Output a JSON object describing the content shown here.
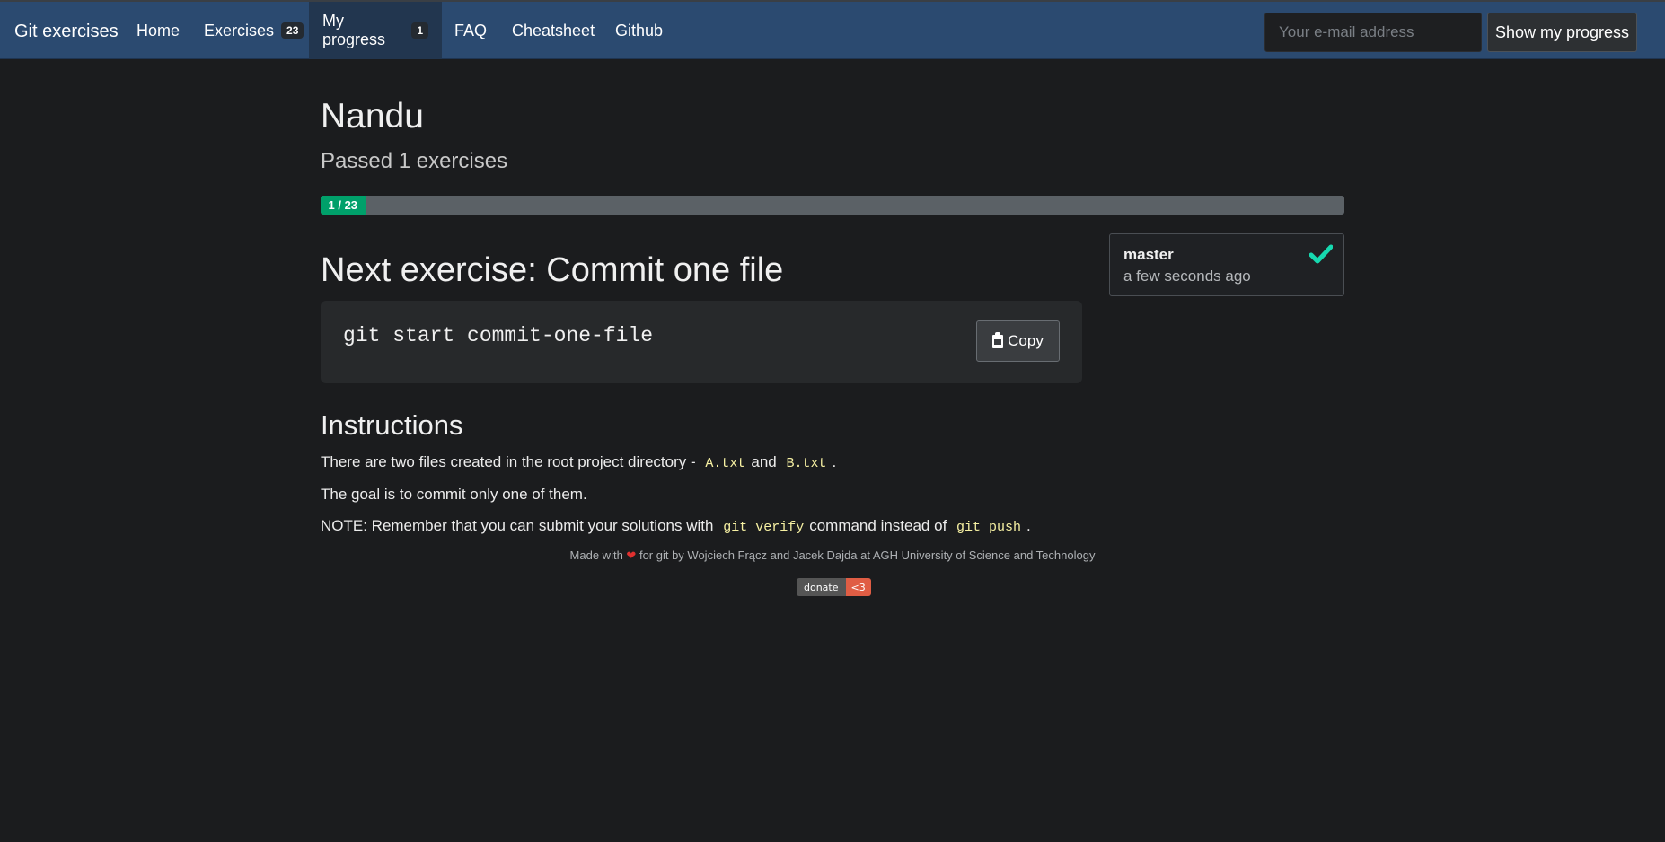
{
  "navbar": {
    "brand": "Git exercises",
    "items": [
      {
        "label": "Home"
      },
      {
        "label": "Exercises",
        "badge": "23"
      },
      {
        "label": "My progress",
        "badge": "1",
        "active": true
      },
      {
        "label": "FAQ"
      },
      {
        "label": "Cheatsheet"
      },
      {
        "label": "Github"
      }
    ],
    "email_placeholder": "Your e-mail address",
    "show_progress_label": "Show my progress"
  },
  "user": {
    "name": "Nandu",
    "passed_text": "Passed 1 exercises"
  },
  "progress": {
    "label": "1 / 23",
    "passed": 1,
    "total": 23
  },
  "next_exercise": {
    "title": "Next exercise: Commit one file",
    "command": "git start commit-one-file",
    "copy_label": "Copy"
  },
  "instructions": {
    "title": "Instructions",
    "line1_text": "There are two files created in the root project directory -",
    "line1_code1": "A.txt",
    "line1_and": "and",
    "line1_code2": "B.txt",
    "line1_end": ".",
    "line2": "The goal is to commit only one of them.",
    "line3_text": "NOTE: Remember that you can submit your solutions with",
    "line3_code1": "git verify",
    "line3_mid": "command instead of",
    "line3_code2": "git push",
    "line3_end": "."
  },
  "branch_card": {
    "branch": "master",
    "time": "a few seconds ago",
    "status_icon": "check-icon",
    "status_color": "#16d9b0"
  },
  "footer": {
    "made_with": "Made with",
    "rest": "for git by Wojciech Frącz and Jacek Dajda at AGH University of Science and Technology",
    "donate_left": "donate",
    "donate_right": "<3"
  },
  "colors": {
    "navbar": "#2b4a70",
    "background": "#1b1c1e",
    "progress_fill": "#00a06a",
    "code_highlight": "#f7f1a3"
  }
}
